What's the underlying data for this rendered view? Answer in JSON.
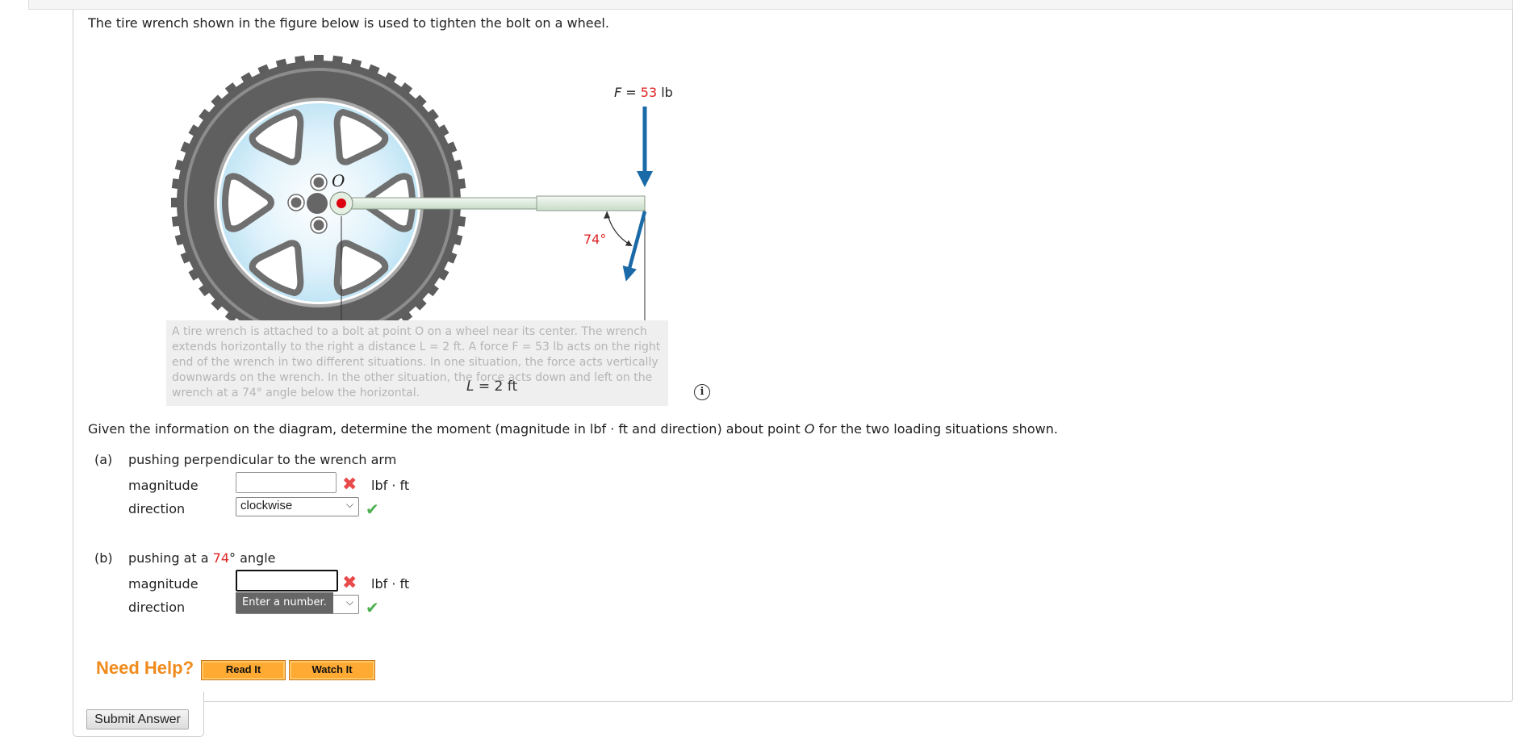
{
  "question": {
    "intro": "The tire wrench shown in the figure below is used to tighten the bolt on a wheel.",
    "prompt_before": "Given the information on the diagram, determine the moment (magnitude in lbf · ft and direction) about point ",
    "prompt_point": "O",
    "prompt_after": " for the two loading situations shown."
  },
  "figure": {
    "point_label": "O",
    "force_label_var": "F",
    "force_label_eq": " = ",
    "force_value": "53",
    "force_unit": " lb",
    "angle_label": "74°",
    "length_label_var": "L",
    "length_label_rest": " = 2 ft",
    "colors": {
      "force_arrow": "#1a6aa8",
      "red_value": "#d22222",
      "dimension_arrow": "#d9495d",
      "bolt": "#dd0011"
    },
    "caption": [
      "A tire wrench is attached to a bolt at point O on a wheel near its center. The wrench",
      "extends horizontally to the right a distance L = 2 ft. A force F = 53 lb acts on the right",
      "end of the wrench in two different situations. In one situation, the force acts vertically",
      "downwards on the wrench. In the other situation, the force acts down and left on the",
      "wrench at a 74° angle below the horizontal."
    ],
    "info_icon": "i"
  },
  "parts": [
    {
      "label": "(a)",
      "title_before": "pushing perpendicular to the wrench arm",
      "title_highlight": "",
      "title_after": "",
      "magnitude_label": "magnitude",
      "magnitude_value": "",
      "magnitude_status": "incorrect",
      "unit": "lbf · ft",
      "direction_label": "direction",
      "direction_value": "clockwise",
      "direction_status": "correct"
    },
    {
      "label": "(b)",
      "title_before": "pushing at a ",
      "title_highlight": "74",
      "title_after": "° angle",
      "magnitude_label": "magnitude",
      "magnitude_value": "",
      "magnitude_status": "incorrect",
      "unit": "lbf · ft",
      "direction_label": "direction",
      "direction_value": "",
      "direction_status": "correct",
      "tooltip": "Enter a number."
    }
  ],
  "help": {
    "label": "Need Help?",
    "read_it": "Read It",
    "watch_it": "Watch It"
  },
  "submit_label": "Submit Answer"
}
